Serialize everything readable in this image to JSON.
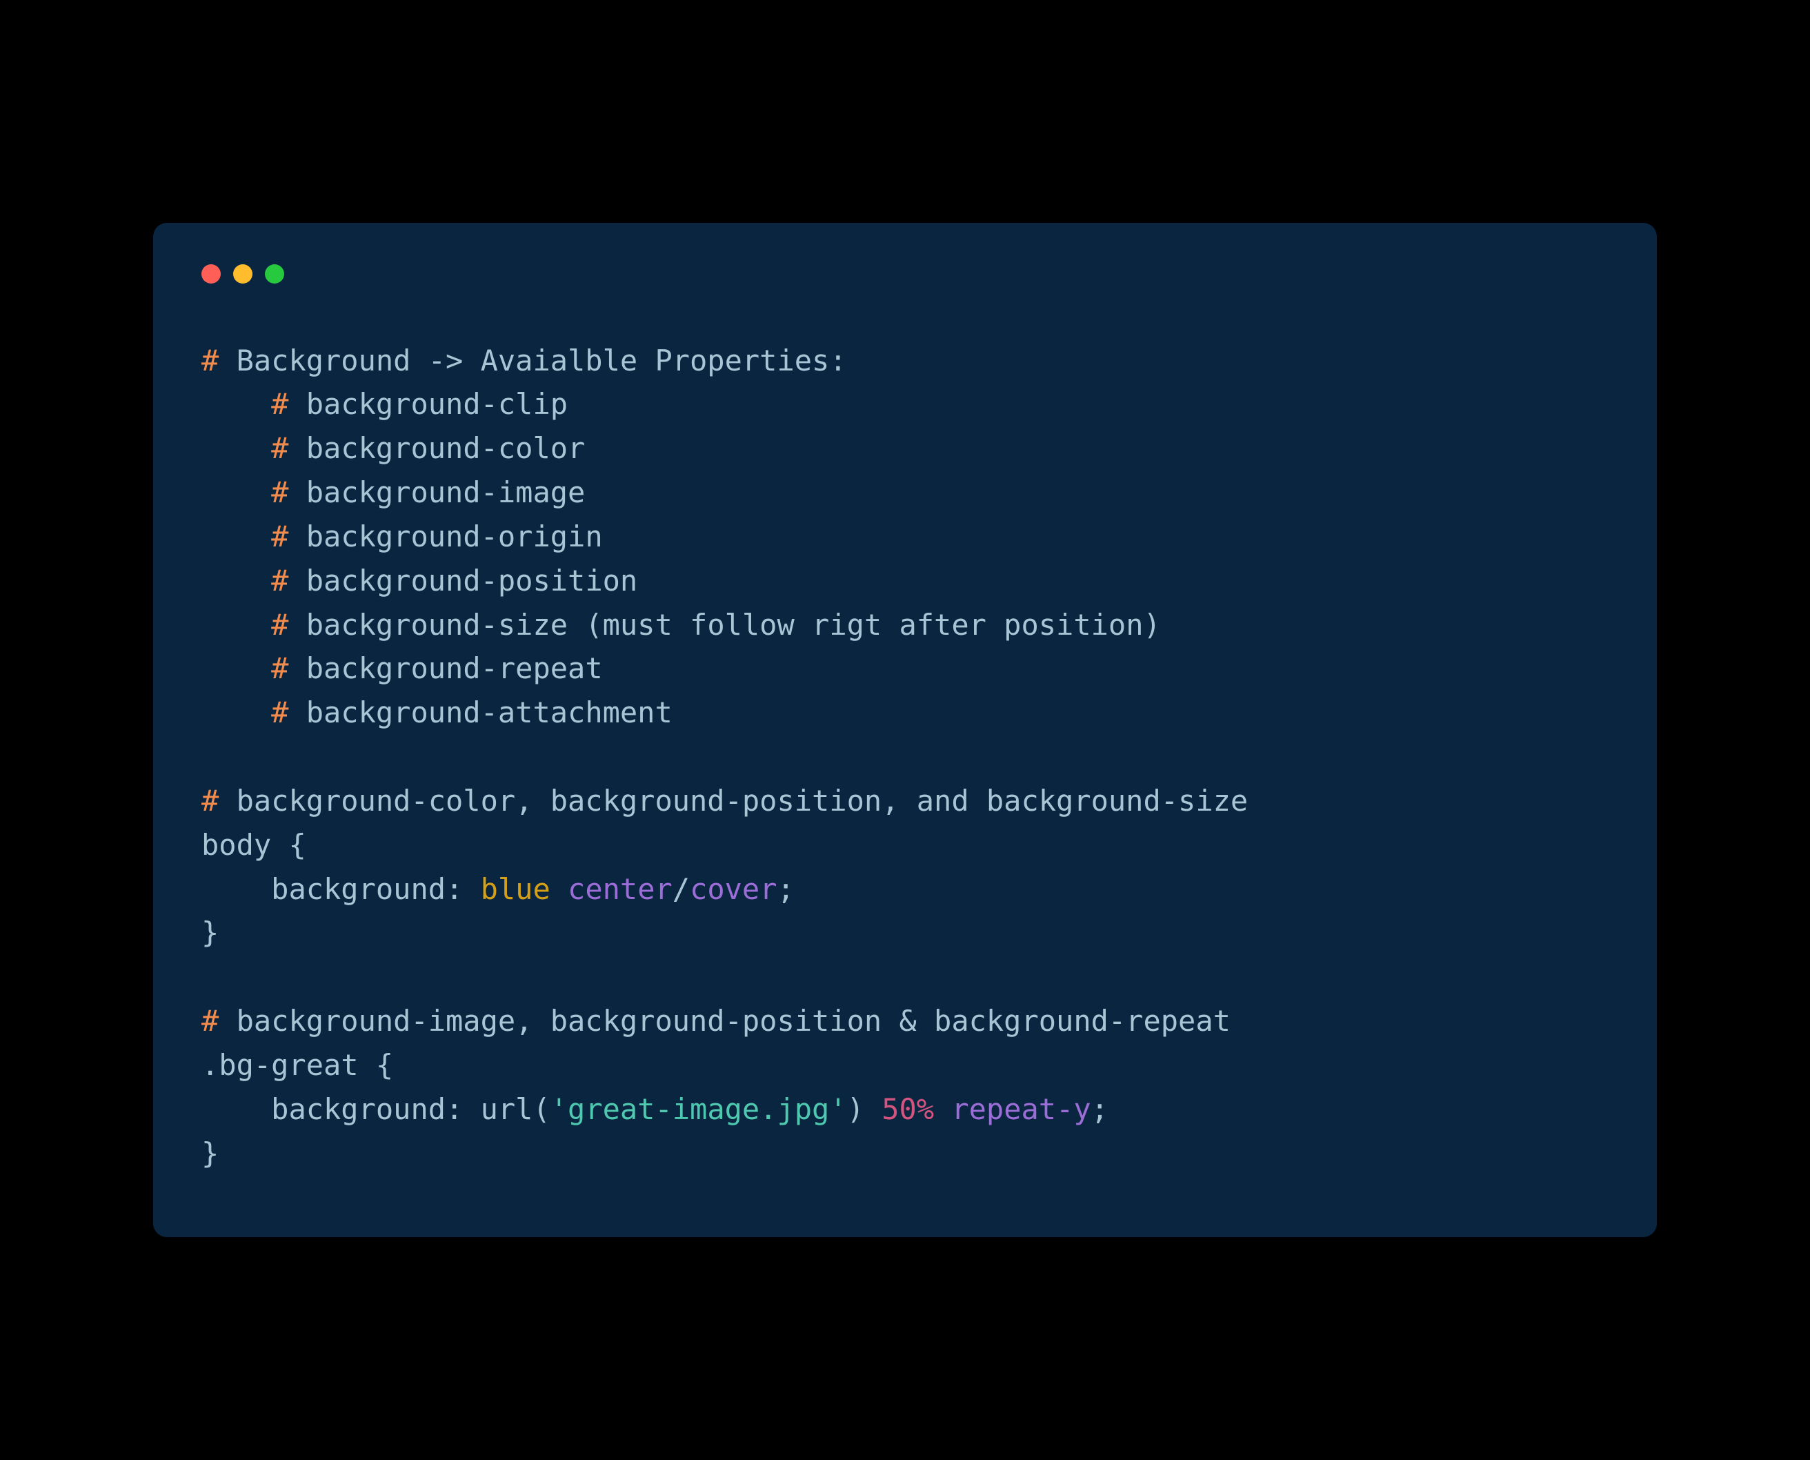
{
  "code": {
    "line1_hash": "#",
    "line1_text": " Background -> Avaialble Properties:",
    "line2_hash": "#",
    "line2_text": " background-clip",
    "line3_hash": "#",
    "line3_text": " background-color",
    "line4_hash": "#",
    "line4_text": " background-image",
    "line5_hash": "#",
    "line5_text": " background-origin",
    "line6_hash": "#",
    "line6_text": " background-position",
    "line7_hash": "#",
    "line7_text": " background-size (must follow rigt after position)",
    "line8_hash": "#",
    "line8_text": " background-repeat",
    "line9_hash": "#",
    "line9_text": " background-attachment",
    "line11_hash": "#",
    "line11_text": " background-color, background-position, and background-size",
    "line12_selector": "body ",
    "line12_brace": "{",
    "line13_indent": "    ",
    "line13_property": "background: ",
    "line13_blue": "blue",
    "line13_space1": " ",
    "line13_center": "center",
    "line13_slash": "/",
    "line13_cover": "cover",
    "line13_semi": ";",
    "line14_brace": "}",
    "line16_hash": "#",
    "line16_text": " background-image, background-position & background-repeat",
    "line17_selector": ".bg-great ",
    "line17_brace": "{",
    "line18_indent": "    ",
    "line18_property": "background: ",
    "line18_url": "url(",
    "line18_string": "'great-image.jpg'",
    "line18_close": ") ",
    "line18_percent": "50%",
    "line18_space": " ",
    "line18_repeat": "repeat-y",
    "line18_semi": ";",
    "line19_brace": "}",
    "indent": "    "
  }
}
